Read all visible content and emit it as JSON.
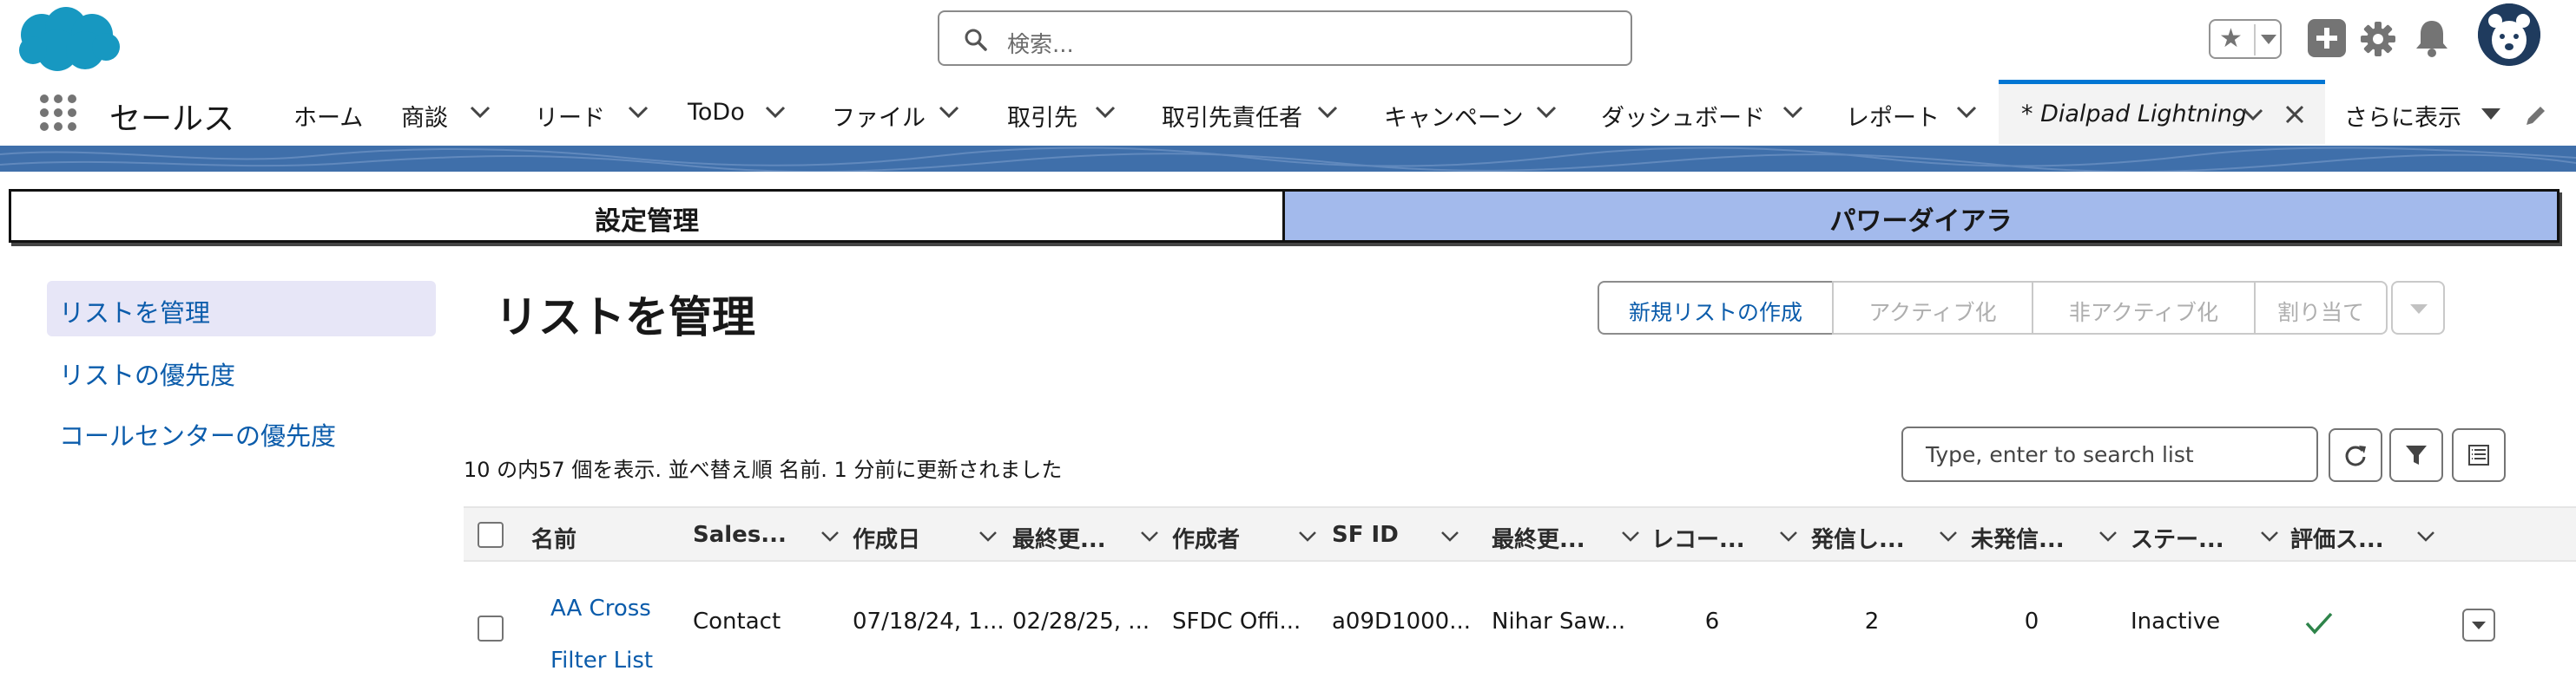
{
  "header": {
    "search_placeholder": "検索...",
    "icons": [
      "salesforce-cloud-logo",
      "search-icon",
      "star-icon",
      "chevron-down-icon",
      "plus-icon",
      "gear-icon",
      "bell-icon",
      "bear-avatar"
    ]
  },
  "nav": {
    "app_name": "セールス",
    "items": [
      "ホーム",
      "商談",
      "リード",
      "ToDo",
      "ファイル",
      "取引先",
      "取引先責任者",
      "キャンペーン",
      "ダッシュボード",
      "レポート"
    ],
    "active_tab": "* Dialpad Lightning",
    "more": "さらに表示"
  },
  "tabs": {
    "settings": "設定管理",
    "power_dialer": "パワーダイアラ"
  },
  "sidebar": {
    "items": [
      "リストを管理",
      "リストの優先度",
      "コールセンターの優先度"
    ]
  },
  "main": {
    "title": "リストを管理",
    "actions": {
      "new_list": "新規リストの作成",
      "activate": "アクティブ化",
      "deactivate": "非アクティブ化",
      "assign": "割り当て"
    },
    "list_status": "10 の内57 個を表示. 並べ替え順 名前. 1 分前に更新されました",
    "search_placeholder": "Type, enter to search list"
  },
  "table": {
    "columns": [
      "名前",
      "Sales...",
      "作成日",
      "最終更...",
      "作成者",
      "SF ID",
      "最終更...",
      "レコー...",
      "発信し...",
      "未発信...",
      "ステー...",
      "評価ス..."
    ],
    "rows": [
      {
        "name_line1": "AA Cross",
        "name_line2": "Filter List",
        "sales": "Contact",
        "created": "07/18/24, 1...",
        "last_modified": "02/28/25, ...",
        "creator": "SFDC Offi...",
        "sf_id": "a09D1000...",
        "last_modified_by": "Nihar Saw...",
        "records": "6",
        "dialed": "2",
        "not_dialed": "0",
        "status": "Inactive",
        "rated": "check"
      }
    ]
  },
  "colors": {
    "brand_blue": "#0176d3",
    "link_blue": "#0b5cab",
    "power_tab": "#a3baec",
    "band": "#3f6faa",
    "check_green": "#2e844a"
  }
}
